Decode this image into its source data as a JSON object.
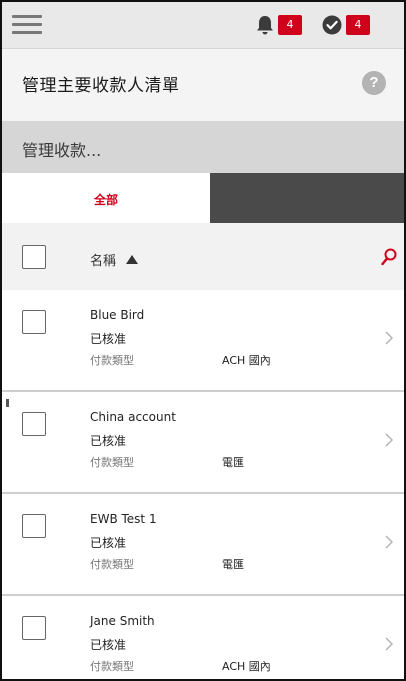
{
  "topbar": {
    "notifications_count": "4",
    "approvals_count": "4"
  },
  "title_bar": {
    "title": "管理主要收款人清單",
    "help_glyph": "?"
  },
  "search": {
    "text": "管理收款..."
  },
  "tabs": [
    {
      "label": "全部",
      "active": true
    },
    {
      "label": "",
      "active": false
    }
  ],
  "list_header": {
    "name_column": "名稱"
  },
  "rows": [
    {
      "name": "Blue Bird",
      "status": "已核准",
      "type_label": "付款類型",
      "type_value": "ACH 國內"
    },
    {
      "name": "China account",
      "status": "已核准",
      "type_label": "付款類型",
      "type_value": "電匯"
    },
    {
      "name": "EWB Test 1",
      "status": "已核准",
      "type_label": "付款類型",
      "type_value": "電匯"
    },
    {
      "name": "Jane Smith",
      "status": "已核准",
      "type_label": "付款類型",
      "type_value": "ACH 國內"
    }
  ],
  "colors": {
    "accent_red": "#d0021b",
    "topbar_bg": "#e9e9e9",
    "search_bg": "#d6d6d6",
    "inactive_tab": "#4a4a4a"
  },
  "icons": {
    "menu": "hamburger-icon",
    "notifications": "bell-icon",
    "approvals": "check-circle-icon",
    "help": "help-icon",
    "search": "search-icon",
    "sort": "sort-ascending-icon",
    "row_arrow": "chevron-right-icon"
  }
}
